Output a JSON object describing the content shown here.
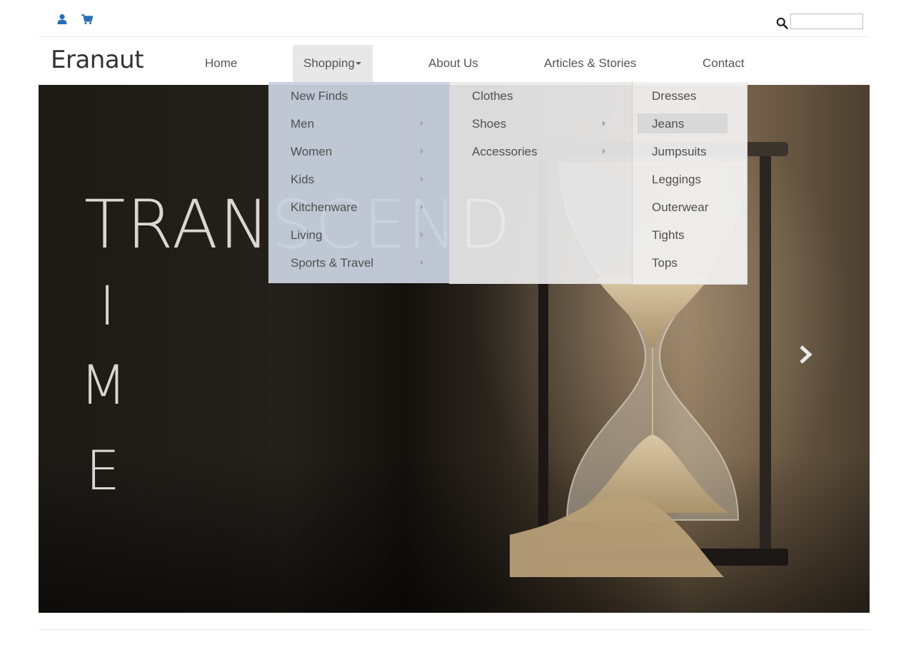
{
  "brand": {
    "name": "Eranaut"
  },
  "topbar": {
    "icons": [
      "user-icon",
      "shopping-cart-icon",
      "search-icon"
    ],
    "search": {
      "value": "",
      "placeholder": ""
    },
    "icon_color": "#2a6ebb"
  },
  "nav": {
    "items": [
      {
        "label": "Home"
      },
      {
        "label": "Shopping"
      },
      {
        "label": "About Us"
      },
      {
        "label": "Articles & Stories"
      },
      {
        "label": "Contact"
      }
    ],
    "active": "Shopping"
  },
  "menu": {
    "level1": [
      {
        "label": "New Finds",
        "has_submenu": false
      },
      {
        "label": "Men",
        "has_submenu": true
      },
      {
        "label": "Women",
        "has_submenu": true
      },
      {
        "label": "Kids",
        "has_submenu": true
      },
      {
        "label": "Kitchenware",
        "has_submenu": true
      },
      {
        "label": "Living",
        "has_submenu": true
      },
      {
        "label": "Sports & Travel",
        "has_submenu": true
      }
    ],
    "level2": [
      {
        "label": "Clothes",
        "has_submenu": false
      },
      {
        "label": "Shoes",
        "has_submenu": true
      },
      {
        "label": "Accessories",
        "has_submenu": true
      }
    ],
    "level3": [
      {
        "label": "Dresses"
      },
      {
        "label": "Jeans"
      },
      {
        "label": "Jumpsuits"
      },
      {
        "label": "Leggings"
      },
      {
        "label": "Outerwear"
      },
      {
        "label": "Tights"
      },
      {
        "label": "Tops"
      }
    ],
    "hovered": "Jeans"
  },
  "hero": {
    "words": [
      "TRANSCEND",
      "I",
      "M",
      "E"
    ],
    "next_icon": "chevron-right-icon"
  }
}
